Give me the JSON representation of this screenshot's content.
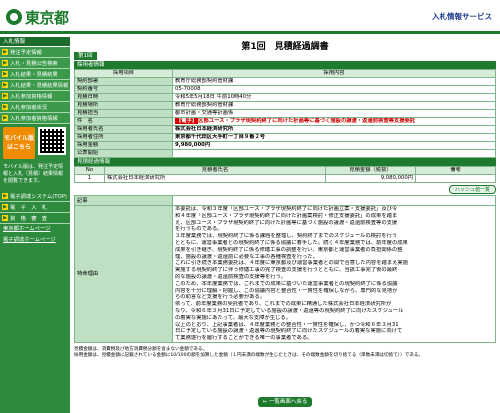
{
  "header": {
    "logo_text": "東京都",
    "system_name": "入札情報サービス"
  },
  "sidebar": {
    "head1": "入札情報",
    "items": [
      "発注予定情報",
      "入札・見積公告検索",
      "入札結果・見積結果",
      "入札結果・見積結果情報",
      "入札参加資格情報",
      "入札参加者状況",
      "入札参加者資格情報"
    ],
    "mobile_label": "モバイル版",
    "mobile_sub": "はこちら",
    "note": "モバイル版は、発注予定情報と入札（見積）結果情報を閲覧できます。",
    "head2": "リンク",
    "links": [
      "電子調達システム(TOP)",
      "電　子　入　札",
      "資　格　審　査"
    ],
    "ext_links": [
      "東京都ホームページ",
      "電子調達ホームページ"
    ]
  },
  "main": {
    "page_title": "第1回　見積経過調書",
    "kaisu": "第1回",
    "section1": "採用者情報",
    "col_item": "採用項目",
    "col_content": "採用内容",
    "rows": [
      {
        "label": "契約部署",
        "value": "教育庁総務部契約管財課"
      },
      {
        "label": "契約番号",
        "value": "05-70008"
      },
      {
        "label": "見積日時",
        "value": "令和5年5月18日 午前10時40分"
      },
      {
        "label": "見積場所",
        "value": "教育庁総務部契約管財課"
      },
      {
        "label": "見積担当",
        "value": "都市計画・交通等計画係"
      },
      {
        "label": "件　名",
        "tag": "【電子】",
        "value": "区部ユース・プラザ現契約終了に向けた計画等に基づく施設の譲渡・返還前検査等支援委託"
      },
      {
        "label": "採用者氏名",
        "value": "株式会社日本経済研究所"
      },
      {
        "label": "採用者住所",
        "value": "東京都千代田区大手町一丁目９番２号"
      },
      {
        "label": "採用金額",
        "value": "9,980,000円"
      },
      {
        "label": "公表開始",
        "value": ""
      }
    ],
    "section2": "見積経過情報",
    "hist_cols": [
      "No",
      "見積者氏名",
      "見積金額（税抜）",
      "備考"
    ],
    "hist_rows": [
      {
        "no": "1",
        "name": "株式会社日本経済研究所",
        "amount": "9,080,000円",
        "note": ""
      }
    ],
    "hist_button": "ハッシュ値一覧",
    "kiji_label": "記事",
    "note_label": "特命理由",
    "note_lines": [
      "本委託は、令和３年度「区部ユース・プラザ現契約終了に向けた計画立案・支援委託」及び令",
      "和４年度「区部ユース・プラザ現契約終了に向けた計画案検討・修正支援委託」の成果を踏ま",
      "え、区部ユース・プラザ現契約終了に向けた計画等に基づく施設の譲渡・返還前検査等の支援",
      "を行うものである。",
      "３年度業務では、現契約終了に係る課題を整理し、契約終了までのスケジュールの検討を行う",
      "とともに、運営事業者との現契約終了に係る協議に着手した。続く４年度業務では、前年度の成果",
      "成果を引き継ぎ、現契約終了に係る修繕工事の調整を行い、東京都と運営事業者の負担関係の整",
      "理、施設の譲渡・返還前に必要な工事の各種検査を行った。",
      "これに引き続き本業務委託は、４年度に東京都及び運営事業者との間で合意した内容を踏まえ実施",
      "実施する現契約終了に伴う修繕工事の完了検査の支援を行うとともに、当該工事完了後の最終",
      "的な施設の譲渡・返還前検査の支援等を行う。",
      "このため、本年度業務では、これまでの成果に基づいた運営事業者との現契約終了に係る協議",
      "内容を十分に理解・把握し、この協議内容と整合性・一貫性を確保しながら、専門的な見地か",
      "らの助言など支援を行う必要がある。",
      "依って、前年度業務の受託者であり、これまでの成果に精通した株式会社日本経済研究所が",
      "なり、令和６年３月31日に予定している施設の譲渡・返還等の現契約終了に向けたスケジュール",
      "の着実な実施にあたって、最大な支障が生じる。",
      "以上のとおり、上記事業者は、４年度業務との整合性・一貫性を確保し、かつ令和６年３月31",
      "日に予定している施設の譲渡・返還等の現契約終了に向けたスケジュールの着実な実施に向けて",
      "て業務遂行を履行することができる唯一の事業者である。"
    ],
    "footer_lines": [
      "見積金額は、消費税及び地方消費税分額を含まない金額である。",
      "採用金額は、見積金額に記載されている金額に10/100の額を加算した金額（１円未満の端数が生じたときは、その端数金額を切り捨てる（単数未満は切捨て））である。"
    ],
    "back_button": "← 一覧画面へ戻る"
  }
}
